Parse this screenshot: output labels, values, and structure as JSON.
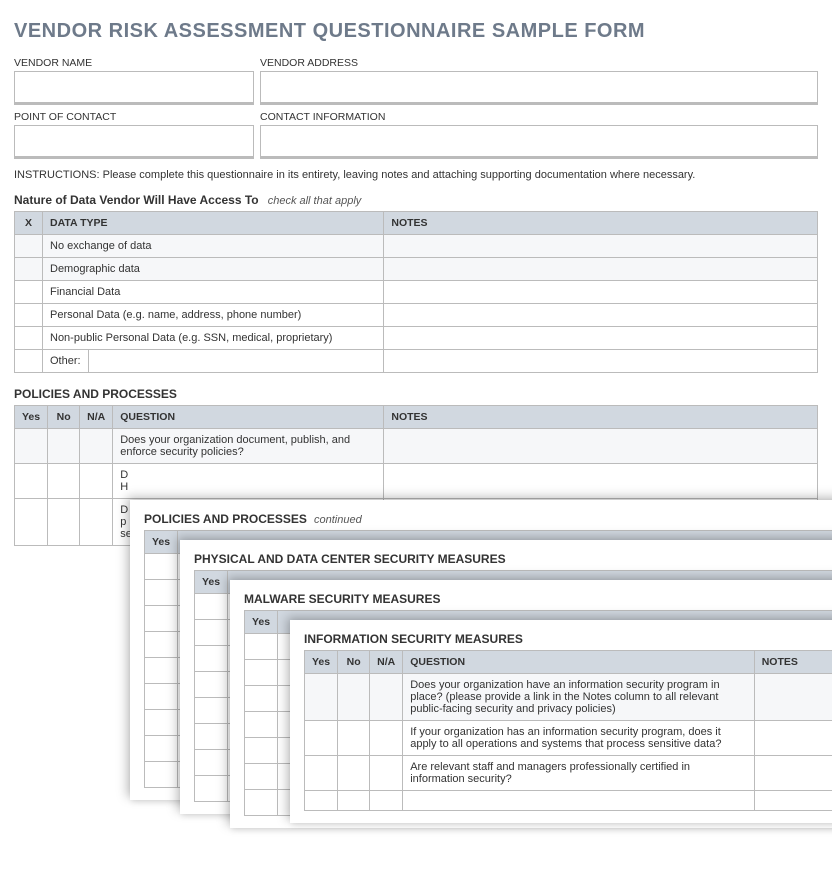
{
  "header": {
    "title": "VENDOR RISK ASSESSMENT QUESTIONNAIRE SAMPLE FORM"
  },
  "fields": {
    "vendor_name_label": "VENDOR NAME",
    "vendor_address_label": "VENDOR ADDRESS",
    "poc_label": "POINT OF CONTACT",
    "contact_info_label": "CONTACT INFORMATION"
  },
  "instructions": "INSTRUCTIONS: Please complete this questionnaire in its entirety, leaving notes and attaching supporting documentation where necessary.",
  "nature": {
    "title": "Nature of Data Vendor Will Have Access To",
    "sub": "check all that apply",
    "headers": {
      "x": "X",
      "data_type": "DATA TYPE",
      "notes": "NOTES"
    },
    "rows": [
      "No exchange of data",
      "Demographic data",
      "Financial Data",
      "Personal Data (e.g. name, address, phone number)",
      "Non-public Personal Data (e.g. SSN, medical, proprietary)"
    ],
    "other_label": "Other:"
  },
  "policies": {
    "title": "POLICIES AND PROCESSES",
    "continued": "continued",
    "headers": {
      "yes": "Yes",
      "no": "No",
      "na": "N/A",
      "question": "QUESTION",
      "notes": "NOTES"
    },
    "questions": [
      "Does your organization document, publish, and enforce security policies?",
      "D\nH",
      "D\np\nse"
    ]
  },
  "physical": {
    "title": "PHYSICAL AND DATA CENTER SECURITY MEASURES",
    "headers": {
      "yes": "Yes"
    }
  },
  "malware": {
    "title": "MALWARE SECURITY MEASURES",
    "headers": {
      "yes": "Yes"
    }
  },
  "infosec": {
    "title": "INFORMATION SECURITY MEASURES",
    "headers": {
      "yes": "Yes",
      "no": "No",
      "na": "N/A",
      "question": "QUESTION",
      "notes": "NOTES"
    },
    "questions": [
      "Does your organization have an information security program in place? (please provide a link in the Notes column to all relevant public-facing security and privacy policies)",
      "If your organization has an information security program, does it apply to all operations and systems that process sensitive data?",
      "Are relevant staff and managers professionally certified in information security?"
    ]
  }
}
